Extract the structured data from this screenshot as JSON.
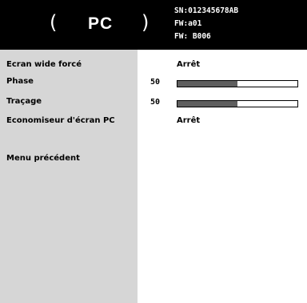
{
  "header": {
    "title": "PC",
    "open_paren": "(",
    "close_paren": ")",
    "serial": "SN:012345678AB",
    "fw1": "FW:a01",
    "fw2": "FW: B006"
  },
  "menu": {
    "items": [
      {
        "label": "Ecran wide forcé",
        "value": "Arrêt"
      },
      {
        "label": "Phase",
        "number": "50",
        "level_fraction": 0.5
      },
      {
        "label": "Traçage",
        "number": "50",
        "level_fraction": 0.5
      },
      {
        "label": "Economiseur d'écran PC",
        "value": "Arrêt"
      },
      {
        "label": "Menu précédent"
      }
    ]
  },
  "colors": {
    "header_bg": "#000000",
    "left_panel_bg": "#d6d6d6",
    "bar_fill": "#5e5e5e"
  }
}
